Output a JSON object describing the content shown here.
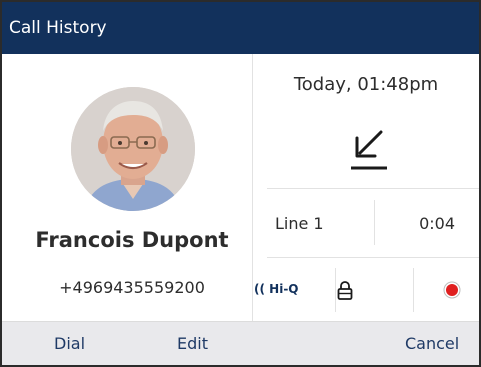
{
  "titlebar": {
    "title": "Call History"
  },
  "contact": {
    "name": "Francois Dupont",
    "number": "+4969435559200"
  },
  "call": {
    "timestamp": "Today, 01:48pm",
    "direction_icon": "incoming-call-arrow-icon",
    "line": "Line 1",
    "duration": "0:04",
    "hiq_label": "Hi-Q"
  },
  "status_icons": [
    "hiq-audio-icon",
    "lock-icon",
    "record-icon"
  ],
  "softkeys": {
    "dial": "Dial",
    "edit": "Edit",
    "cancel": "Cancel"
  },
  "colors": {
    "titlebar": "#12315c",
    "record": "#e02020",
    "softkey_bar": "#e9e9ec",
    "softkey_text": "#1f3a66"
  }
}
